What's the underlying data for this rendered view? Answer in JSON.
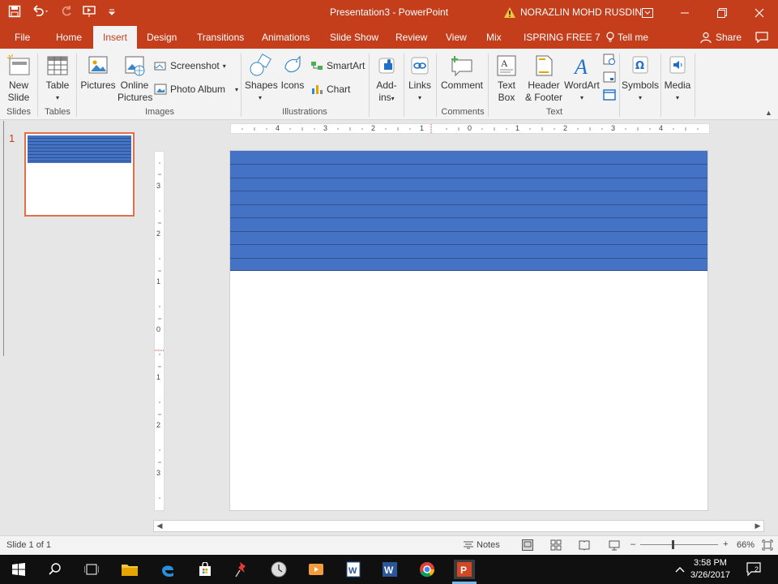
{
  "window": {
    "title": "Presentation3  -  PowerPoint",
    "user": "NORAZLIN MOHD RUSDIN",
    "accent": "#c43e1c"
  },
  "tabs": [
    {
      "label": "File"
    },
    {
      "label": "Home"
    },
    {
      "label": "Insert"
    },
    {
      "label": "Design"
    },
    {
      "label": "Transitions"
    },
    {
      "label": "Animations"
    },
    {
      "label": "Slide Show"
    },
    {
      "label": "Review"
    },
    {
      "label": "View"
    },
    {
      "label": "Mix"
    },
    {
      "label": "ISPRING FREE 7"
    },
    {
      "label": "Tell me"
    }
  ],
  "share_label": "Share",
  "ribbon": {
    "new_slide": "New\nSlide",
    "table": "Table",
    "pictures": "Pictures",
    "online_pictures": "Online\nPictures",
    "screenshot": "Screenshot",
    "photo_album": "Photo Album",
    "shapes": "Shapes",
    "icons": "Icons",
    "smartart": "SmartArt",
    "chart": "Chart",
    "addins": "Add-\nins",
    "links": "Links",
    "comment": "Comment",
    "text_box": "Text\nBox",
    "header_footer": "Header\n& Footer",
    "wordart": "WordArt",
    "symbols": "Symbols",
    "media": "Media",
    "groups": {
      "slides": "Slides",
      "tables": "Tables",
      "images": "Images",
      "illustrations": "Illustrations",
      "comments": "Comments",
      "text": "Text"
    }
  },
  "thumbnail": {
    "number": "1"
  },
  "ruler": {
    "h_labels": [
      "4",
      "3",
      "2",
      "1",
      "0",
      "1",
      "2",
      "3",
      "4"
    ],
    "v_labels": [
      "3",
      "2",
      "1",
      "0",
      "1",
      "2",
      "3"
    ]
  },
  "slide": {
    "table_fill": "#4472c4",
    "table_rows": 9
  },
  "status": {
    "slide_info": "Slide 1 of 1",
    "notes": "Notes",
    "zoom_minus": "–",
    "zoom_plus": "+",
    "zoom": "66%"
  },
  "taskbar": {
    "time": "3:58 PM",
    "date": "3/26/2017",
    "notifications": "2"
  }
}
